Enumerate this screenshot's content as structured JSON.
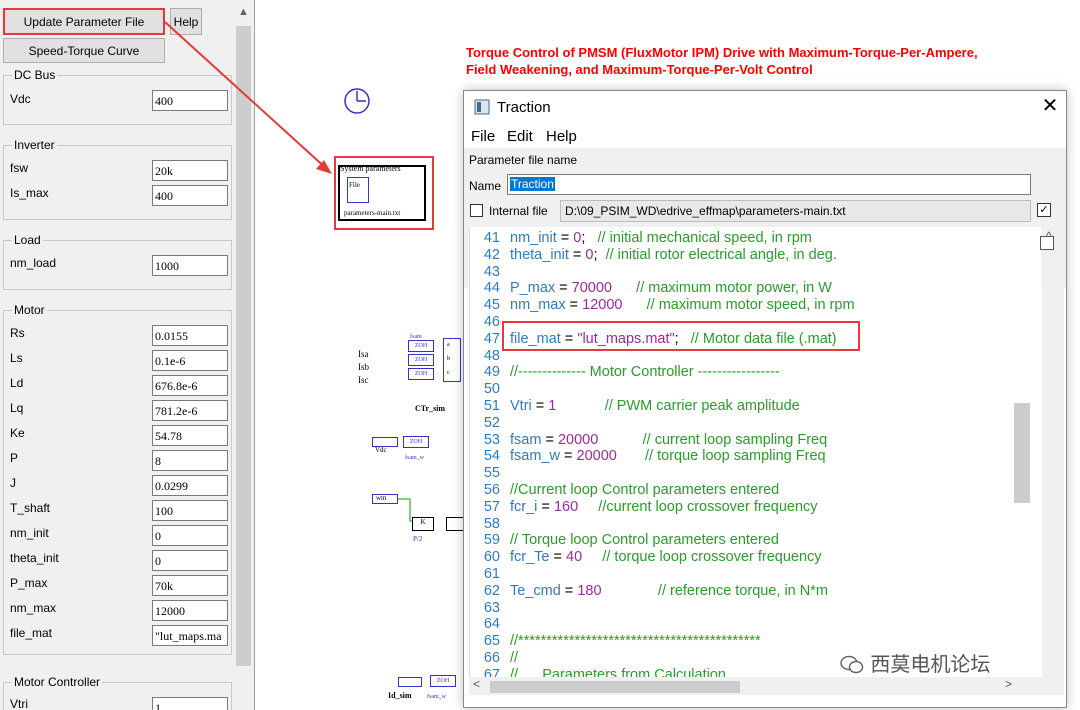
{
  "left_panel": {
    "update_button": "Update Parameter File",
    "help_button": "Help",
    "speed_torque_button": "Speed-Torque Curve",
    "groups": {
      "dc_bus": {
        "title": "DC Bus",
        "fields": [
          {
            "label": "Vdc",
            "value": "400"
          }
        ]
      },
      "inverter": {
        "title": "Inverter",
        "fields": [
          {
            "label": "fsw",
            "value": "20k"
          },
          {
            "label": "Is_max",
            "value": "400"
          }
        ]
      },
      "load": {
        "title": "Load",
        "fields": [
          {
            "label": "nm_load",
            "value": "1000"
          }
        ]
      },
      "motor": {
        "title": "Motor",
        "fields": [
          {
            "label": "Rs",
            "value": "0.0155"
          },
          {
            "label": "Ls",
            "value": "0.1e-6"
          },
          {
            "label": "Ld",
            "value": "676.8e-6"
          },
          {
            "label": "Lq",
            "value": "781.2e-6"
          },
          {
            "label": "Ke",
            "value": "54.78"
          },
          {
            "label": "P",
            "value": "8"
          },
          {
            "label": "J",
            "value": "0.0299"
          },
          {
            "label": "T_shaft",
            "value": "100"
          },
          {
            "label": "nm_init",
            "value": "0"
          },
          {
            "label": "theta_init",
            "value": "0"
          },
          {
            "label": "P_max",
            "value": "70k"
          },
          {
            "label": "nm_max",
            "value": "12000"
          },
          {
            "label": "file_mat",
            "value": "\"lut_maps.ma"
          }
        ]
      },
      "motor_controller": {
        "title": "Motor Controller",
        "fields": [
          {
            "label": "Vtri",
            "value": "1"
          }
        ]
      }
    }
  },
  "schematic": {
    "title_line1": "Torque Control of PMSM (FluxMotor IPM) Drive with Maximum-Torque-Per-Ampere,",
    "title_line2": "Field Weakening, and Maximum-Torque-Per-Volt Control",
    "sysparam_title": "System parameters",
    "sysparam_file_label": "File",
    "sysparam_filename": "parameters-main.txt",
    "labels": {
      "isa": "Isa",
      "isb": "Isb",
      "isc": "Isc",
      "ctr_sim": "CTr_sim",
      "fsam": "fsam",
      "zoh": "ZOH",
      "vdc": "Vdc",
      "fsam_w": "fsam_w",
      "wm": "wm",
      "k": "K",
      "p2": "P/2",
      "id_sim": "Id_sim",
      "a": "a",
      "b": "b",
      "c": "c"
    },
    "watermark": "西莫电机论坛"
  },
  "dialog": {
    "title": "Traction",
    "menu": [
      "File",
      "Edit",
      "Help"
    ],
    "param_file_heading": "Parameter file name",
    "name_label": "Name",
    "name_value": "Traction",
    "internal_file_label": "Internal file",
    "path_value": "D:\\09_PSIM_WD\\edrive_effmap\\parameters-main.txt",
    "lines": [
      {
        "n": "41",
        "parts": [
          [
            "var",
            "nm_init"
          ],
          [
            "op",
            " = "
          ],
          [
            "num",
            "0"
          ],
          [
            "op",
            ";   "
          ],
          [
            "cmt",
            "// initial mechanical speed, in rpm"
          ]
        ]
      },
      {
        "n": "42",
        "parts": [
          [
            "var",
            "theta_init"
          ],
          [
            "op",
            " = "
          ],
          [
            "num",
            "0"
          ],
          [
            "op",
            ";  "
          ],
          [
            "cmt",
            "// initial rotor electrical angle, in deg."
          ]
        ]
      },
      {
        "n": "43",
        "parts": []
      },
      {
        "n": "44",
        "parts": [
          [
            "var",
            "P_max"
          ],
          [
            "op",
            " = "
          ],
          [
            "num",
            "70000"
          ],
          [
            "op",
            "      "
          ],
          [
            "cmt",
            "// maximum motor power, in W"
          ]
        ]
      },
      {
        "n": "45",
        "parts": [
          [
            "var",
            "nm_max"
          ],
          [
            "op",
            " = "
          ],
          [
            "num",
            "12000"
          ],
          [
            "op",
            "      "
          ],
          [
            "cmt",
            "// maximum motor speed, in rpm"
          ]
        ]
      },
      {
        "n": "46",
        "parts": []
      },
      {
        "n": "47",
        "parts": [
          [
            "var",
            "file_mat"
          ],
          [
            "op",
            " = "
          ],
          [
            "str",
            "\"lut_maps.mat\""
          ],
          [
            "op",
            ";   "
          ],
          [
            "cmt",
            "// Motor data file (.mat)"
          ]
        ]
      },
      {
        "n": "48",
        "parts": []
      },
      {
        "n": "49",
        "parts": [
          [
            "cmt",
            "//-------------- Motor Controller -----------------"
          ]
        ]
      },
      {
        "n": "50",
        "parts": []
      },
      {
        "n": "51",
        "parts": [
          [
            "var",
            "Vtri"
          ],
          [
            "op",
            " = "
          ],
          [
            "num",
            "1"
          ],
          [
            "op",
            "            "
          ],
          [
            "cmt",
            "// PWM carrier peak amplitude"
          ]
        ]
      },
      {
        "n": "52",
        "parts": []
      },
      {
        "n": "53",
        "parts": [
          [
            "var",
            "fsam"
          ],
          [
            "op",
            " = "
          ],
          [
            "num",
            "20000"
          ],
          [
            "op",
            "           "
          ],
          [
            "cmt",
            "// current loop sampling Freq"
          ]
        ]
      },
      {
        "n": "54",
        "parts": [
          [
            "var",
            "fsam_w"
          ],
          [
            "op",
            " = "
          ],
          [
            "num",
            "20000"
          ],
          [
            "op",
            "       "
          ],
          [
            "cmt",
            "// torque loop sampling Freq"
          ]
        ]
      },
      {
        "n": "55",
        "parts": []
      },
      {
        "n": "56",
        "parts": [
          [
            "cmt",
            "//Current loop Control parameters entered"
          ]
        ]
      },
      {
        "n": "57",
        "parts": [
          [
            "var",
            "fcr_i"
          ],
          [
            "op",
            " = "
          ],
          [
            "num",
            "160"
          ],
          [
            "op",
            "     "
          ],
          [
            "cmt",
            "//current loop crossover frequency"
          ]
        ]
      },
      {
        "n": "58",
        "parts": []
      },
      {
        "n": "59",
        "parts": [
          [
            "cmt",
            "// Torque loop Control parameters entered"
          ]
        ]
      },
      {
        "n": "60",
        "parts": [
          [
            "var",
            "fcr_Te"
          ],
          [
            "op",
            " = "
          ],
          [
            "num",
            "40"
          ],
          [
            "op",
            "     "
          ],
          [
            "cmt",
            "// torque loop crossover frequency"
          ]
        ]
      },
      {
        "n": "61",
        "parts": []
      },
      {
        "n": "62",
        "parts": [
          [
            "var",
            "Te_cmd"
          ],
          [
            "op",
            " = "
          ],
          [
            "num",
            "180"
          ],
          [
            "op",
            "              "
          ],
          [
            "cmt",
            "// reference torque, in N*m"
          ]
        ]
      },
      {
        "n": "63",
        "parts": []
      },
      {
        "n": "64",
        "parts": []
      },
      {
        "n": "65",
        "parts": [
          [
            "cmt",
            "//*******************************************"
          ]
        ]
      },
      {
        "n": "66",
        "parts": [
          [
            "cmt",
            "//"
          ]
        ]
      },
      {
        "n": "67",
        "parts": [
          [
            "cmt",
            "//      Parameters from Calculation"
          ]
        ]
      }
    ]
  },
  "colors": {
    "annotation_red": "#e63a3a",
    "title_red": "#ff0000",
    "code_blue": "#2e7bbf",
    "code_green": "#2a9c2a",
    "code_purple": "#9c2a9c"
  }
}
